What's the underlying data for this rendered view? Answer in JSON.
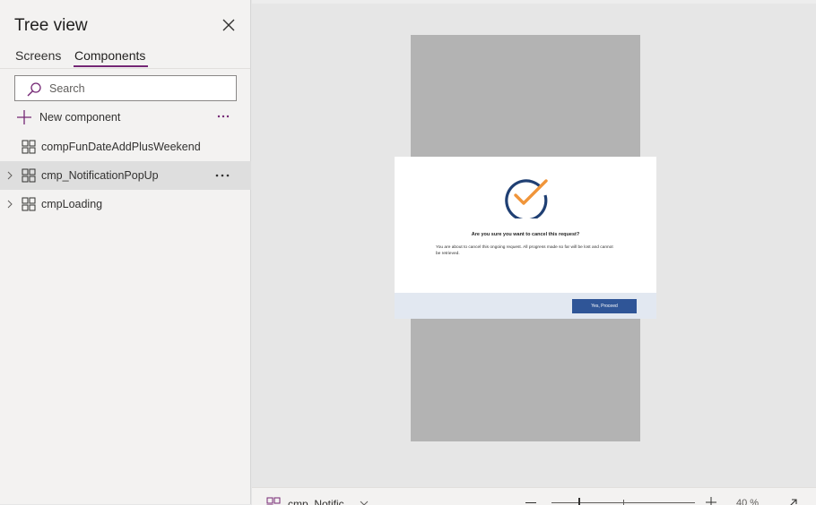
{
  "tree": {
    "title": "Tree view",
    "tabs": [
      {
        "label": "Screens"
      },
      {
        "label": "Components"
      }
    ],
    "search": {
      "placeholder": "Search"
    },
    "new_component_label": "New component",
    "items": [
      {
        "label": "compFunDateAddPlusWeekend",
        "expandable": false,
        "selected": false
      },
      {
        "label": "cmp_NotificationPopUp",
        "expandable": true,
        "selected": true
      },
      {
        "label": "cmpLoading",
        "expandable": true,
        "selected": false
      }
    ]
  },
  "dialog": {
    "title": "Are you sure you want to cancel this request?",
    "body": "You are about to cancel this ongoing request. All progress made so far will be lost and cannot be retrieved.",
    "proceed_label": "Yes, Proceed",
    "check_colors": {
      "ring": "#1f3f73",
      "check": "#f0953a"
    }
  },
  "bottom_bar": {
    "component_name": "cmp_Notific",
    "zoom": "40 %"
  },
  "colors": {
    "accent": "#742774",
    "button": "#2f5597"
  }
}
